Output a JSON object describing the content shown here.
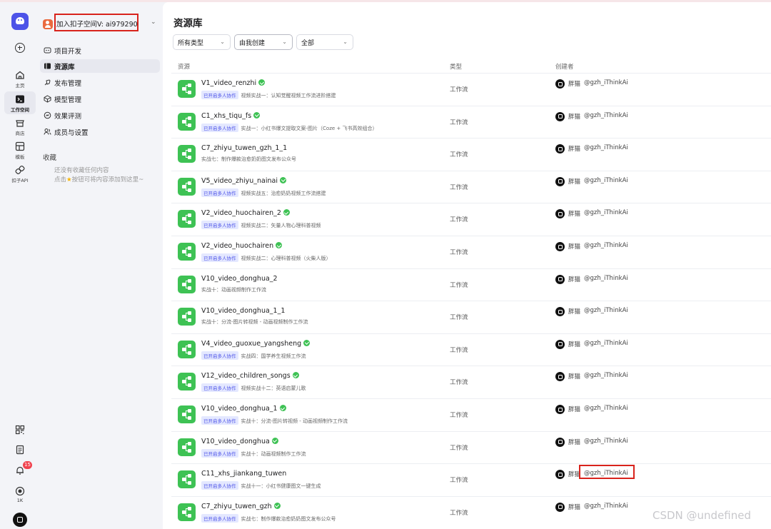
{
  "rail": {
    "items": [
      {
        "label": "主页",
        "icon": "home-icon"
      },
      {
        "label": "工作空间",
        "icon": "terminal-icon"
      },
      {
        "label": "商店",
        "icon": "store-icon"
      },
      {
        "label": "模板",
        "icon": "template-icon"
      },
      {
        "label": "扣子API",
        "icon": "api-link-icon"
      }
    ],
    "notification_count": "15",
    "badge_label": "1K"
  },
  "sidebar": {
    "workspace_name": "加入扣子空间V: ai979290",
    "nav": [
      {
        "label": "项目开发",
        "icon": "project-icon"
      },
      {
        "label": "资源库",
        "icon": "library-icon"
      },
      {
        "label": "发布管理",
        "icon": "publish-icon"
      },
      {
        "label": "模型管理",
        "icon": "model-icon"
      },
      {
        "label": "效果评测",
        "icon": "evaluate-icon"
      },
      {
        "label": "成员与设置",
        "icon": "members-icon"
      }
    ],
    "favorites_title": "收藏",
    "favorites_empty_1": "还没有收藏任何内容",
    "favorites_empty_2a": "点击",
    "favorites_empty_2b": "按钮可将内容添加到这里~"
  },
  "main": {
    "title": "资源库",
    "filters": [
      {
        "value": "所有类型"
      },
      {
        "value": "由我创建"
      },
      {
        "value": "全部"
      }
    ],
    "columns": {
      "resource": "资源",
      "type": "类型",
      "creator": "创建者"
    },
    "rows": [
      {
        "name": "V1_video_renzhi",
        "verified": true,
        "tag": "已开启多人协作",
        "desc": "视频实战一：认知觉醒视频工作流进阶搭建",
        "type": "工作流",
        "creator": "胖猫",
        "handle": "@gzh_iThinkAi"
      },
      {
        "name": "C1_xhs_tiqu_fs",
        "verified": true,
        "tag": "已开启多人协作",
        "desc": "实战一：小红书爆文提取文案-图片（Coze + 飞书高效组合）",
        "type": "工作流",
        "creator": "胖猫",
        "handle": "@gzh_iThinkAi"
      },
      {
        "name": "C7_zhiyu_tuwen_gzh_1_1",
        "verified": false,
        "tag": "",
        "desc": "实战七：制作爆款治愈奶奶图文发布公众号",
        "type": "工作流",
        "creator": "胖猫",
        "handle": "@gzh_iThinkAi"
      },
      {
        "name": "V5_video_zhiyu_nainai",
        "verified": true,
        "tag": "已开启多人协作",
        "desc": "视频实战五：治愈奶奶视频工作流搭建",
        "type": "工作流",
        "creator": "胖猫",
        "handle": "@gzh_iThinkAi"
      },
      {
        "name": "V2_video_huochairen_2",
        "verified": true,
        "tag": "已开启多人协作",
        "desc": "视频实战二：矢量人物心理科普视频",
        "type": "工作流",
        "creator": "胖猫",
        "handle": "@gzh_iThinkAi"
      },
      {
        "name": "V2_video_huochairen",
        "verified": true,
        "tag": "已开启多人协作",
        "desc": "视频实战二：心理科普视频（火柴人版）",
        "type": "工作流",
        "creator": "胖猫",
        "handle": "@gzh_iThinkAi"
      },
      {
        "name": "V10_video_donghua_2",
        "verified": false,
        "tag": "",
        "desc": "实战十：动画视频制作工作流",
        "type": "工作流",
        "creator": "胖猫",
        "handle": "@gzh_iThinkAi"
      },
      {
        "name": "V10_video_donghua_1_1",
        "verified": false,
        "tag": "",
        "desc": "实战十：分流-图片转视频 - 动画视频制作工作流",
        "type": "工作流",
        "creator": "胖猫",
        "handle": "@gzh_iThinkAi"
      },
      {
        "name": "V4_video_guoxue_yangsheng",
        "verified": true,
        "tag": "已开启多人协作",
        "desc": "实战四：国学养生视频工作流",
        "type": "工作流",
        "creator": "胖猫",
        "handle": "@gzh_iThinkAi"
      },
      {
        "name": "V12_video_children_songs",
        "verified": true,
        "tag": "已开启多人协作",
        "desc": "视频实战十二：英语启蒙儿歌",
        "type": "工作流",
        "creator": "胖猫",
        "handle": "@gzh_iThinkAi"
      },
      {
        "name": "V10_video_donghua_1",
        "verified": true,
        "tag": "已开启多人协作",
        "desc": "实战十：分流-图片转视频 - 动画视频制作工作流",
        "type": "工作流",
        "creator": "胖猫",
        "handle": "@gzh_iThinkAi"
      },
      {
        "name": "V10_video_donghua",
        "verified": true,
        "tag": "已开启多人协作",
        "desc": "实战十：动画视频制作工作流",
        "type": "工作流",
        "creator": "胖猫",
        "handle": "@gzh_iThinkAi"
      },
      {
        "name": "C11_xhs_jiankang_tuwen",
        "verified": false,
        "tag": "已开启多人协作",
        "desc": "实战十一：小红书健康图文一键生成",
        "type": "工作流",
        "creator": "胖猫",
        "handle": "@gzh_iThinkAi",
        "highlight": true
      },
      {
        "name": "C7_zhiyu_tuwen_gzh",
        "verified": true,
        "tag": "已开启多人协作",
        "desc": "实战七：制作爆款治愈奶奶图文发布公众号",
        "type": "工作流",
        "creator": "胖猫",
        "handle": "@gzh_iThinkAi"
      }
    ]
  },
  "watermark": "CSDN @undefined",
  "colors": {
    "accent": "#4d53e8",
    "workflow_green": "#3ec254",
    "highlight_red": "#d8231c",
    "badge_red": "#f0434f"
  }
}
